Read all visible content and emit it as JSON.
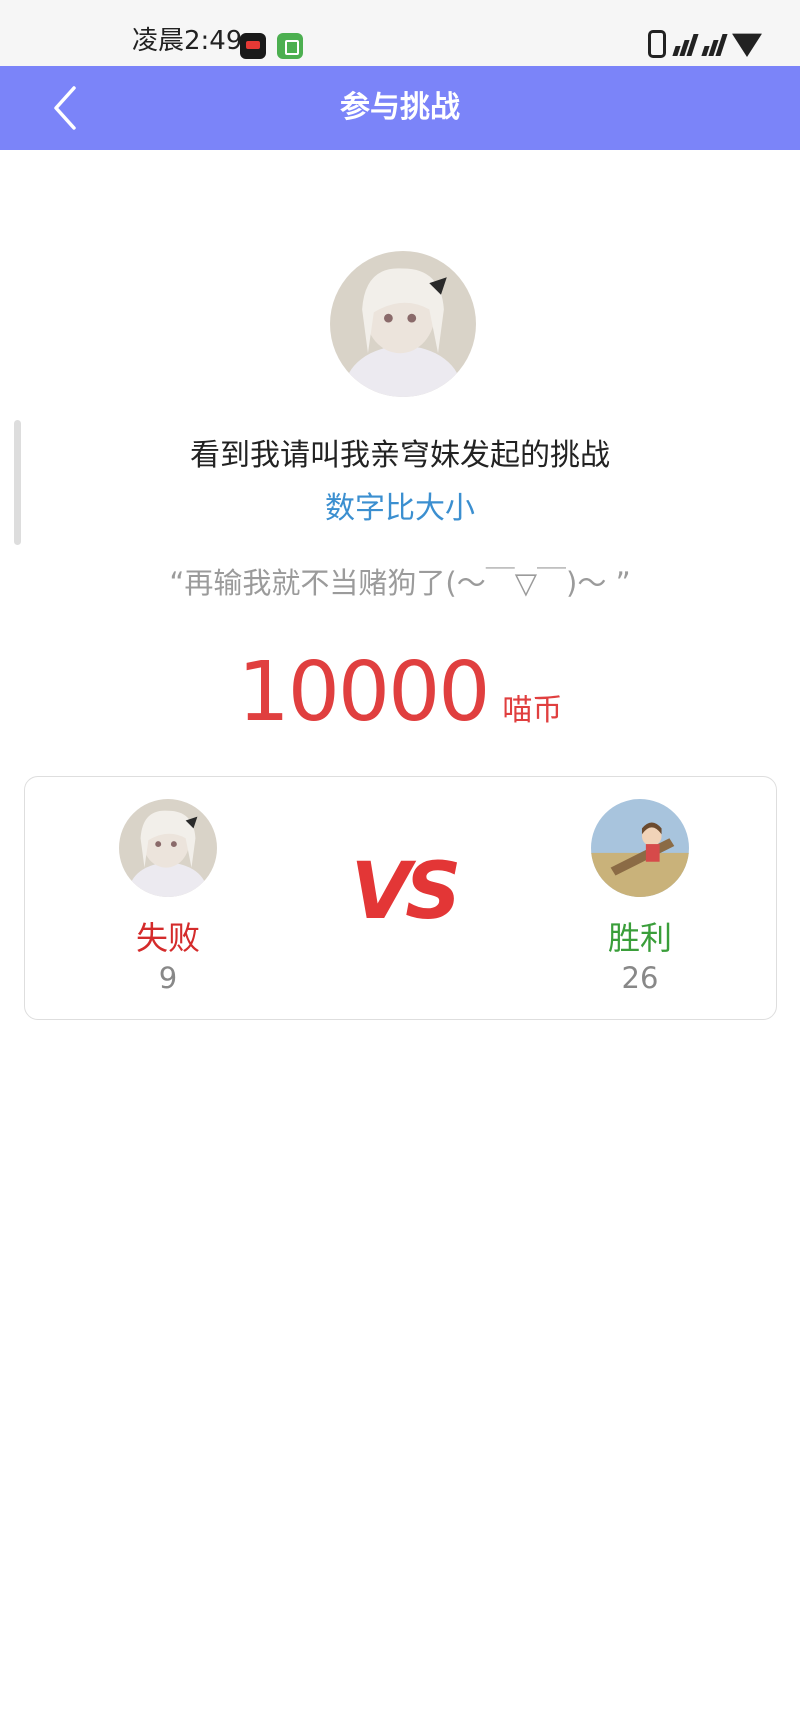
{
  "status_bar": {
    "time": "凌晨2:49"
  },
  "header": {
    "title": "参与挑战",
    "back_icon": "chevron-left-icon"
  },
  "challenge": {
    "description": "看到我请叫我亲穹妹发起的挑战",
    "game_type": "数字比大小",
    "quote": "“再输我就不当赌狗了(～￣▽￣)～ ”",
    "stake_amount": "10000",
    "stake_unit": "喵币"
  },
  "versus": {
    "vs_label": "VS",
    "left": {
      "result": "失败",
      "count": "9"
    },
    "right": {
      "result": "胜利",
      "count": "26"
    }
  },
  "colors": {
    "header_bg": "#7b84f9",
    "link_blue": "#3b8fd0",
    "stake_red": "#e03f3f",
    "lose_red": "#d42b2b",
    "win_green": "#3a9e3a"
  }
}
